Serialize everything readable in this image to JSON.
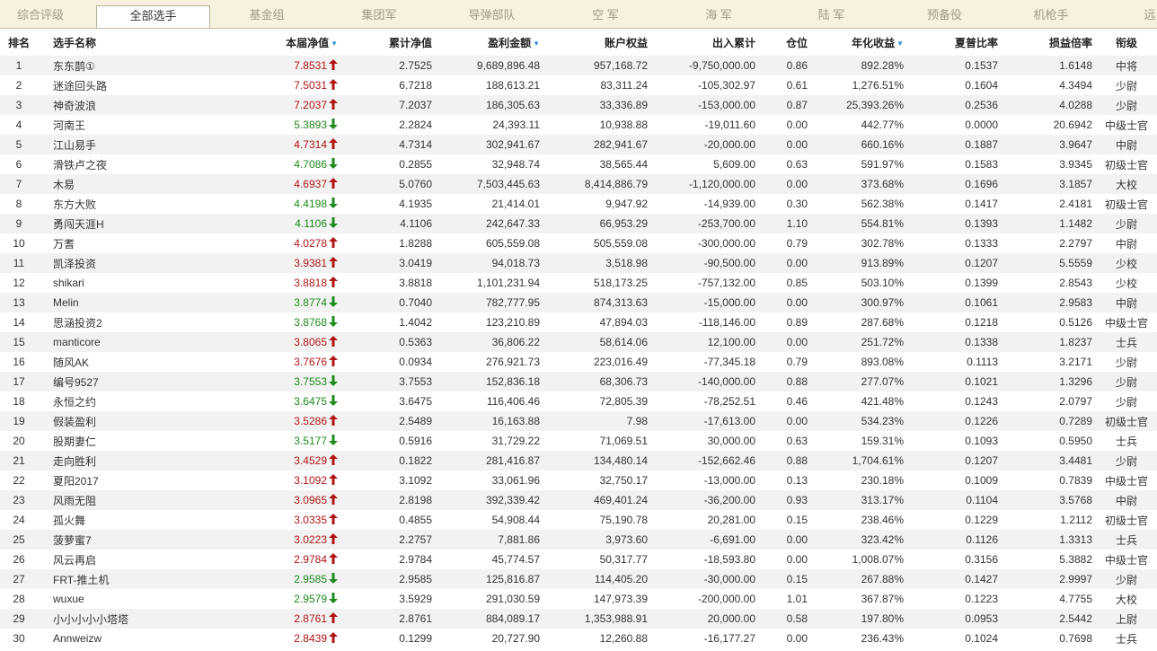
{
  "tabs": [
    "综合评级",
    "全部选手",
    "基金组",
    "集团军",
    "导弹部队",
    "空 军",
    "海 军",
    "陆 军",
    "预备役",
    "机枪手",
    "远"
  ],
  "active_tab": 1,
  "headers": {
    "rank": "排名",
    "name": "选手名称",
    "nav": "本届净值",
    "cum_nav": "累计净值",
    "profit": "盈利金额",
    "equity": "账户权益",
    "flow": "出入累计",
    "position": "仓位",
    "annual": "年化收益",
    "sharpe": "夏普比率",
    "pl_ratio": "损益倍率",
    "rank_title": "衔级"
  },
  "colors": {
    "up": "#b01414",
    "down": "#1c8a1c",
    "sort_icon": "#2d8fd6"
  },
  "rows": [
    {
      "rank": "1",
      "name": "东东鹊①",
      "nav": "7.8531",
      "dir": "up",
      "cum_nav": "2.7525",
      "profit": "9,689,896.48",
      "equity": "957,168.72",
      "flow": "-9,750,000.00",
      "position": "0.86",
      "annual": "892.28%",
      "sharpe": "0.1537",
      "pl_ratio": "1.6148",
      "title": "中将"
    },
    {
      "rank": "2",
      "name": "迷途回头路",
      "nav": "7.5031",
      "dir": "up",
      "cum_nav": "6.7218",
      "profit": "188,613.21",
      "equity": "83,311.24",
      "flow": "-105,302.97",
      "position": "0.61",
      "annual": "1,276.51%",
      "sharpe": "0.1604",
      "pl_ratio": "4.3494",
      "title": "少尉"
    },
    {
      "rank": "3",
      "name": "神奇波浪",
      "nav": "7.2037",
      "dir": "up",
      "cum_nav": "7.2037",
      "profit": "186,305.63",
      "equity": "33,336.89",
      "flow": "-153,000.00",
      "position": "0.87",
      "annual": "25,393.26%",
      "sharpe": "0.2536",
      "pl_ratio": "4.0288",
      "title": "少尉"
    },
    {
      "rank": "4",
      "name": "河南王",
      "nav": "5.3893",
      "dir": "down",
      "cum_nav": "2.2824",
      "profit": "24,393.11",
      "equity": "10,938.88",
      "flow": "-19,011.60",
      "position": "0.00",
      "annual": "442.77%",
      "sharpe": "0.0000",
      "pl_ratio": "20.6942",
      "title": "中级士官"
    },
    {
      "rank": "5",
      "name": "江山易手",
      "nav": "4.7314",
      "dir": "up",
      "cum_nav": "4.7314",
      "profit": "302,941.67",
      "equity": "282,941.67",
      "flow": "-20,000.00",
      "position": "0.00",
      "annual": "660.16%",
      "sharpe": "0.1887",
      "pl_ratio": "3.9647",
      "title": "中尉"
    },
    {
      "rank": "6",
      "name": "滑铁卢之夜",
      "nav": "4.7086",
      "dir": "down",
      "cum_nav": "0.2855",
      "profit": "32,948.74",
      "equity": "38,565.44",
      "flow": "5,609.00",
      "position": "0.63",
      "annual": "591.97%",
      "sharpe": "0.1583",
      "pl_ratio": "3.9345",
      "title": "初级士官"
    },
    {
      "rank": "7",
      "name": "木易",
      "nav": "4.6937",
      "dir": "up",
      "cum_nav": "5.0760",
      "profit": "7,503,445.63",
      "equity": "8,414,886.79",
      "flow": "-1,120,000.00",
      "position": "0.00",
      "annual": "373.68%",
      "sharpe": "0.1696",
      "pl_ratio": "3.1857",
      "title": "大校"
    },
    {
      "rank": "8",
      "name": "东方大败",
      "nav": "4.4198",
      "dir": "down",
      "cum_nav": "4.1935",
      "profit": "21,414.01",
      "equity": "9,947.92",
      "flow": "-14,939.00",
      "position": "0.30",
      "annual": "562.38%",
      "sharpe": "0.1417",
      "pl_ratio": "2.4181",
      "title": "初级士官"
    },
    {
      "rank": "9",
      "name": "勇闯天涯H",
      "nav": "4.1106",
      "dir": "down",
      "cum_nav": "4.1106",
      "profit": "242,647.33",
      "equity": "66,953.29",
      "flow": "-253,700.00",
      "position": "1.10",
      "annual": "554.81%",
      "sharpe": "0.1393",
      "pl_ratio": "1.1482",
      "title": "少尉"
    },
    {
      "rank": "10",
      "name": "万耆",
      "nav": "4.0278",
      "dir": "up",
      "cum_nav": "1.8288",
      "profit": "605,559.08",
      "equity": "505,559.08",
      "flow": "-300,000.00",
      "position": "0.79",
      "annual": "302.78%",
      "sharpe": "0.1333",
      "pl_ratio": "2.2797",
      "title": "中尉"
    },
    {
      "rank": "11",
      "name": "凯泽投资",
      "nav": "3.9381",
      "dir": "up",
      "cum_nav": "3.0419",
      "profit": "94,018.73",
      "equity": "3,518.98",
      "flow": "-90,500.00",
      "position": "0.00",
      "annual": "913.89%",
      "sharpe": "0.1207",
      "pl_ratio": "5.5559",
      "title": "少校"
    },
    {
      "rank": "12",
      "name": "shikari",
      "nav": "3.8818",
      "dir": "up",
      "cum_nav": "3.8818",
      "profit": "1,101,231.94",
      "equity": "518,173.25",
      "flow": "-757,132.00",
      "position": "0.85",
      "annual": "503.10%",
      "sharpe": "0.1399",
      "pl_ratio": "2.8543",
      "title": "少校"
    },
    {
      "rank": "13",
      "name": "Melin",
      "nav": "3.8774",
      "dir": "down",
      "cum_nav": "0.7040",
      "profit": "782,777.95",
      "equity": "874,313.63",
      "flow": "-15,000.00",
      "position": "0.00",
      "annual": "300.97%",
      "sharpe": "0.1061",
      "pl_ratio": "2.9583",
      "title": "中尉"
    },
    {
      "rank": "14",
      "name": "思涵投资2",
      "nav": "3.8768",
      "dir": "down",
      "cum_nav": "1.4042",
      "profit": "123,210.89",
      "equity": "47,894.03",
      "flow": "-118,146.00",
      "position": "0.89",
      "annual": "287.68%",
      "sharpe": "0.1218",
      "pl_ratio": "0.5126",
      "title": "中级士官"
    },
    {
      "rank": "15",
      "name": "manticore",
      "nav": "3.8065",
      "dir": "up",
      "cum_nav": "0.5363",
      "profit": "36,806.22",
      "equity": "58,614.06",
      "flow": "12,100.00",
      "position": "0.00",
      "annual": "251.72%",
      "sharpe": "0.1338",
      "pl_ratio": "1.8237",
      "title": "士兵"
    },
    {
      "rank": "16",
      "name": "随风AK",
      "nav": "3.7676",
      "dir": "up",
      "cum_nav": "0.0934",
      "profit": "276,921.73",
      "equity": "223,016.49",
      "flow": "-77,345.18",
      "position": "0.79",
      "annual": "893.08%",
      "sharpe": "0.1113",
      "pl_ratio": "3.2171",
      "title": "少尉"
    },
    {
      "rank": "17",
      "name": "编号9527",
      "nav": "3.7553",
      "dir": "down",
      "cum_nav": "3.7553",
      "profit": "152,836.18",
      "equity": "68,306.73",
      "flow": "-140,000.00",
      "position": "0.88",
      "annual": "277.07%",
      "sharpe": "0.1021",
      "pl_ratio": "1.3296",
      "title": "少尉"
    },
    {
      "rank": "18",
      "name": "永恒之约",
      "nav": "3.6475",
      "dir": "down",
      "cum_nav": "3.6475",
      "profit": "116,406.46",
      "equity": "72,805.39",
      "flow": "-78,252.51",
      "position": "0.46",
      "annual": "421.48%",
      "sharpe": "0.1243",
      "pl_ratio": "2.0797",
      "title": "少尉"
    },
    {
      "rank": "19",
      "name": "假装盈利",
      "nav": "3.5286",
      "dir": "up",
      "cum_nav": "2.5489",
      "profit": "16,163.88",
      "equity": "7.98",
      "flow": "-17,613.00",
      "position": "0.00",
      "annual": "534.23%",
      "sharpe": "0.1226",
      "pl_ratio": "0.7289",
      "title": "初级士官"
    },
    {
      "rank": "20",
      "name": "股期妻仁",
      "nav": "3.5177",
      "dir": "down",
      "cum_nav": "0.5916",
      "profit": "31,729.22",
      "equity": "71,069.51",
      "flow": "30,000.00",
      "position": "0.63",
      "annual": "159.31%",
      "sharpe": "0.1093",
      "pl_ratio": "0.5950",
      "title": "士兵"
    },
    {
      "rank": "21",
      "name": "走向胜利",
      "nav": "3.4529",
      "dir": "up",
      "cum_nav": "0.1822",
      "profit": "281,416.87",
      "equity": "134,480.14",
      "flow": "-152,662.46",
      "position": "0.88",
      "annual": "1,704.61%",
      "sharpe": "0.1207",
      "pl_ratio": "3.4481",
      "title": "少尉"
    },
    {
      "rank": "22",
      "name": "夏阳2017",
      "nav": "3.1092",
      "dir": "up",
      "cum_nav": "3.1092",
      "profit": "33,061.96",
      "equity": "32,750.17",
      "flow": "-13,000.00",
      "position": "0.13",
      "annual": "230.18%",
      "sharpe": "0.1009",
      "pl_ratio": "0.7839",
      "title": "中级士官"
    },
    {
      "rank": "23",
      "name": "风雨无阻",
      "nav": "3.0965",
      "dir": "up",
      "cum_nav": "2.8198",
      "profit": "392,339.42",
      "equity": "469,401.24",
      "flow": "-36,200.00",
      "position": "0.93",
      "annual": "313.17%",
      "sharpe": "0.1104",
      "pl_ratio": "3.5768",
      "title": "中尉"
    },
    {
      "rank": "24",
      "name": "孤火舞",
      "nav": "3.0335",
      "dir": "up",
      "cum_nav": "0.4855",
      "profit": "54,908.44",
      "equity": "75,190.78",
      "flow": "20,281.00",
      "position": "0.15",
      "annual": "238.46%",
      "sharpe": "0.1229",
      "pl_ratio": "1.2112",
      "title": "初级士官"
    },
    {
      "rank": "25",
      "name": "菠萝蜜7",
      "nav": "3.0223",
      "dir": "up",
      "cum_nav": "2.2757",
      "profit": "7,881.86",
      "equity": "3,973.60",
      "flow": "-6,691.00",
      "position": "0.00",
      "annual": "323.42%",
      "sharpe": "0.1126",
      "pl_ratio": "1.3313",
      "title": "士兵"
    },
    {
      "rank": "26",
      "name": "风云再启",
      "nav": "2.9784",
      "dir": "up",
      "cum_nav": "2.9784",
      "profit": "45,774.57",
      "equity": "50,317.77",
      "flow": "-18,593.80",
      "position": "0.00",
      "annual": "1,008.07%",
      "sharpe": "0.3156",
      "pl_ratio": "5.3882",
      "title": "中级士官"
    },
    {
      "rank": "27",
      "name": "FRT-推土机",
      "nav": "2.9585",
      "dir": "down",
      "cum_nav": "2.9585",
      "profit": "125,816.87",
      "equity": "114,405.20",
      "flow": "-30,000.00",
      "position": "0.15",
      "annual": "267.88%",
      "sharpe": "0.1427",
      "pl_ratio": "2.9997",
      "title": "少尉"
    },
    {
      "rank": "28",
      "name": "wuxue",
      "nav": "2.9579",
      "dir": "down",
      "cum_nav": "3.5929",
      "profit": "291,030.59",
      "equity": "147,973.39",
      "flow": "-200,000.00",
      "position": "1.01",
      "annual": "367.87%",
      "sharpe": "0.1223",
      "pl_ratio": "4.7755",
      "title": "大校"
    },
    {
      "rank": "29",
      "name": "小小小小小塔塔",
      "nav": "2.8761",
      "dir": "up",
      "cum_nav": "2.8761",
      "profit": "884,089.17",
      "equity": "1,353,988.91",
      "flow": "20,000.00",
      "position": "0.58",
      "annual": "197.80%",
      "sharpe": "0.0953",
      "pl_ratio": "2.5442",
      "title": "上尉"
    },
    {
      "rank": "30",
      "name": "Annweizw",
      "nav": "2.8439",
      "dir": "up",
      "cum_nav": "0.1299",
      "profit": "20,727.90",
      "equity": "12,260.88",
      "flow": "-16,177.27",
      "position": "0.00",
      "annual": "236.43%",
      "sharpe": "0.1024",
      "pl_ratio": "0.7698",
      "title": "士兵"
    }
  ]
}
